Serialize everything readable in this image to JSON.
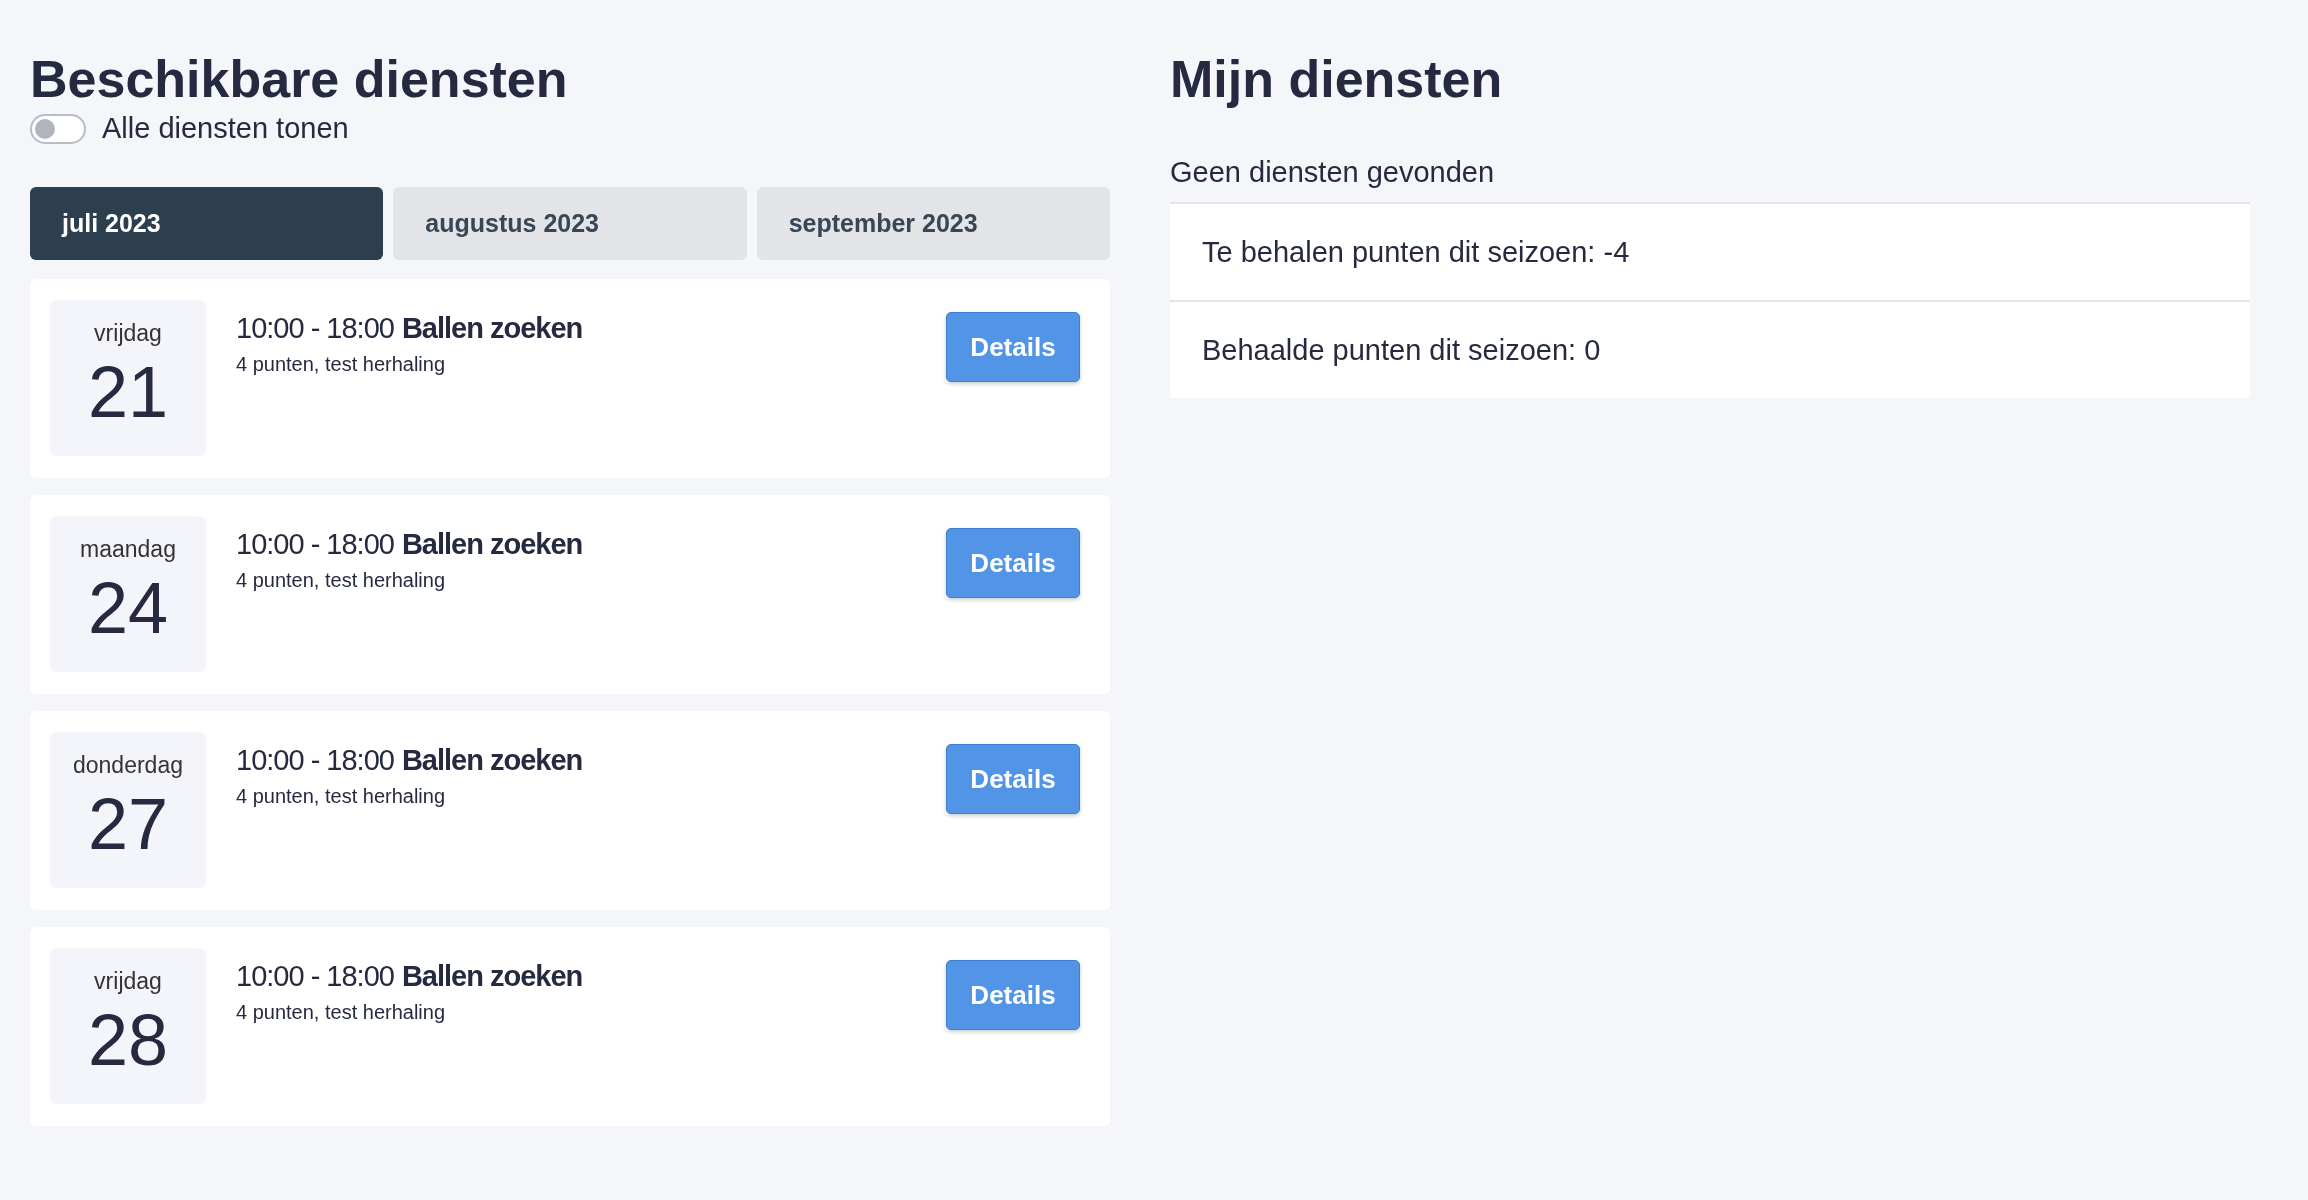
{
  "available": {
    "title": "Beschikbare diensten",
    "toggle": {
      "label": "Alle diensten tonen",
      "on": false
    },
    "tabs": [
      {
        "label": "juli 2023",
        "selected": true
      },
      {
        "label": "augustus 2023",
        "selected": false
      },
      {
        "label": "september 2023",
        "selected": false
      }
    ],
    "shifts": [
      {
        "weekday": "vrijdag",
        "day": "21",
        "time": "10:00 - 18:00",
        "name": "Ballen zoeken",
        "description": "4 punten, test herhaling",
        "button": "Details"
      },
      {
        "weekday": "maandag",
        "day": "24",
        "time": "10:00 - 18:00",
        "name": "Ballen zoeken",
        "description": "4 punten, test herhaling",
        "button": "Details"
      },
      {
        "weekday": "donderdag",
        "day": "27",
        "time": "10:00 - 18:00",
        "name": "Ballen zoeken",
        "description": "4 punten, test herhaling",
        "button": "Details"
      },
      {
        "weekday": "vrijdag",
        "day": "28",
        "time": "10:00 - 18:00",
        "name": "Ballen zoeken",
        "description": "4 punten, test herhaling",
        "button": "Details"
      }
    ]
  },
  "mine": {
    "title": "Mijn diensten",
    "empty_message": "Geen diensten gevonden",
    "stats": [
      "Te behalen punten dit seizoen: -4",
      "Behaalde punten dit seizoen: 0"
    ]
  }
}
